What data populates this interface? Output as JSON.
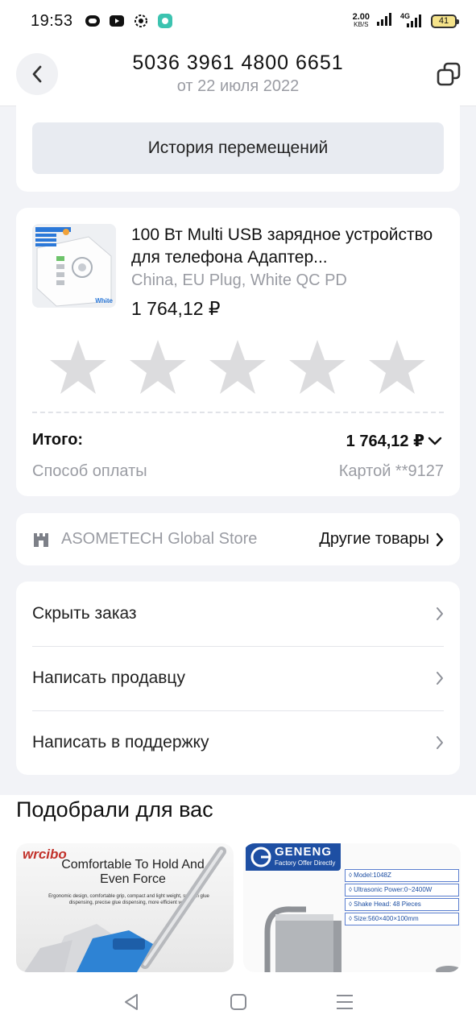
{
  "status_bar": {
    "time": "19:53",
    "net_speed_value": "2.00",
    "net_speed_unit": "KB/S",
    "network_type": "4G",
    "battery": "41",
    "icons": [
      "app-icon",
      "youtube-icon",
      "settings-icon",
      "messenger-icon",
      "signal-icon",
      "signal-4g-icon",
      "battery-icon"
    ]
  },
  "header": {
    "title": "5036 3961 4800 6651",
    "subtitle": "от 22 июля 2022",
    "back_icon": "back-chevron-icon",
    "copy_icon": "copy-icon"
  },
  "history": {
    "button_label": "История перемещений"
  },
  "product": {
    "name": "100 Вт Multi USB зарядное устройство для телефона Адаптер...",
    "variant": "China, EU Plug, White QC PD",
    "price": "1 764,12 ₽",
    "thumb_label": "White",
    "rating_stars_total": 5,
    "rating_stars_filled": 0,
    "star_color": "#dcdcde"
  },
  "summary": {
    "total_label": "Итого:",
    "total_value": "1 764,12 ₽",
    "payment_label": "Способ оплаты",
    "payment_value": "Картой **9127"
  },
  "store": {
    "name": "ASOMETECH Global Store",
    "link_label": "Другие товары"
  },
  "actions": [
    {
      "label": "Скрыть заказ"
    },
    {
      "label": "Написать продавцу"
    },
    {
      "label": "Написать в поддержку"
    }
  ],
  "recommendations": {
    "title": "Подобрали для вас",
    "items": [
      {
        "brand": "wrcibo",
        "headline": "Comfortable To Hold And Even Force",
        "description": "Ergonomic design, comfortable grip, compact and light weight, smooth glue dispensing, precise glue dispensing, more efficient work"
      },
      {
        "brand": "GENENG",
        "tagline": "Factory Offer Directly",
        "specs": [
          "◊ Model:1048Z",
          "◊ Ultrasonic Power:0~2400W",
          "◊ Shake Head: 48 Pieces",
          "◊ Size:560×400×100mm"
        ]
      }
    ]
  },
  "nav_bar": {
    "icons": [
      "nav-back-icon",
      "nav-home-icon",
      "nav-menu-icon"
    ]
  },
  "colors": {
    "background": "#f2f3f7",
    "card": "#ffffff",
    "muted_text": "#9a9ca3",
    "history_button": "#e8ebf1",
    "brand_blue": "#1e4fa3"
  }
}
